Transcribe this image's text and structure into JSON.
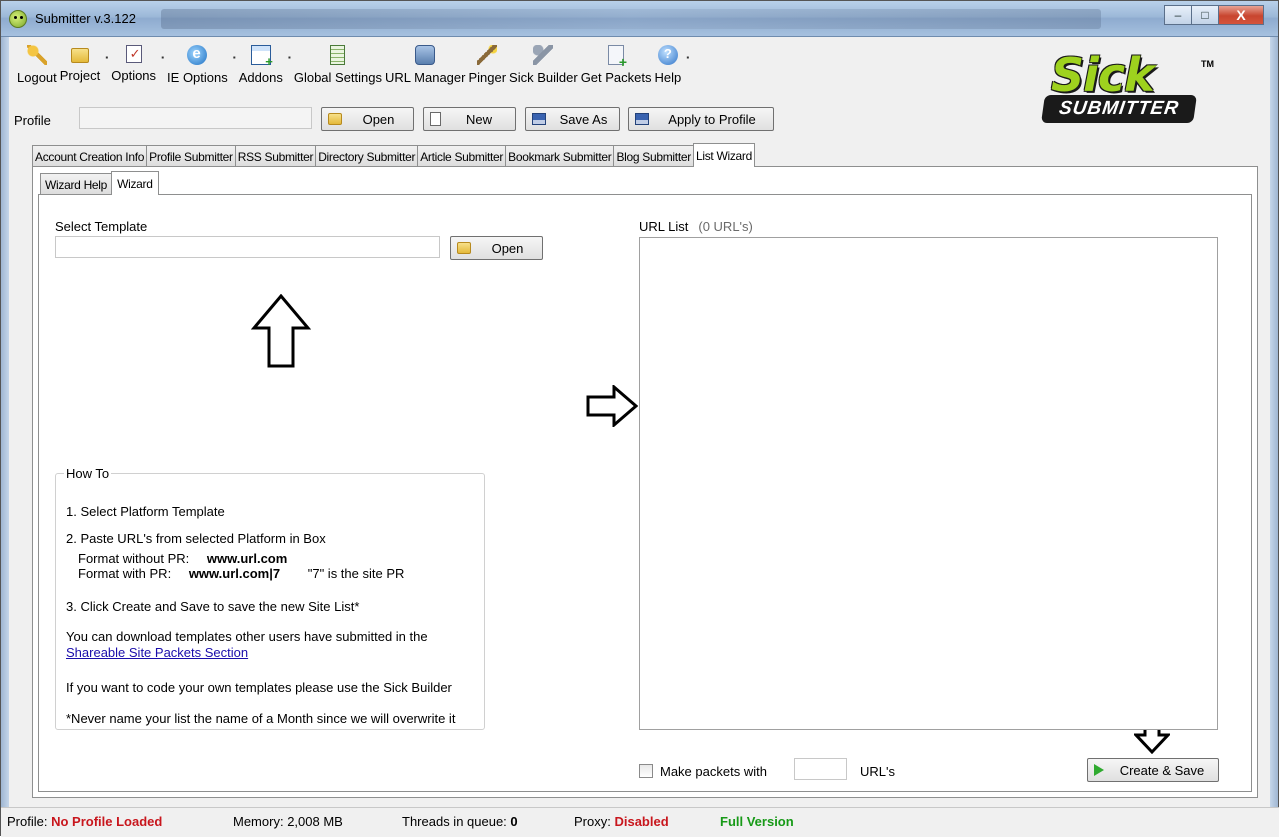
{
  "window": {
    "title": "Submitter v.3.122",
    "minimize": "–",
    "maximize": "□",
    "close": "X"
  },
  "toolbar": {
    "items": [
      {
        "label": "Logout",
        "icon": "key-icon"
      },
      {
        "label": "Project",
        "icon": "folder-icon"
      },
      {
        "label": "Options",
        "icon": "checklist-icon"
      },
      {
        "label": "IE Options",
        "icon": "ie-icon"
      },
      {
        "label": "Addons",
        "icon": "add-window-icon"
      },
      {
        "label": "Global Settings",
        "icon": "document-icon"
      },
      {
        "label": "URL Manager",
        "icon": "globe-icon"
      },
      {
        "label": "Pinger",
        "icon": "wand-icon"
      },
      {
        "label": "Sick Builder",
        "icon": "wrench-icon"
      },
      {
        "label": "Get Packets",
        "icon": "packets-icon"
      },
      {
        "label": "Help",
        "icon": "help-icon"
      }
    ]
  },
  "logo": {
    "top": "Sick",
    "bottom": "SUBMITTER",
    "tm": "TM"
  },
  "profile": {
    "label": "Profile",
    "value": "",
    "open": "Open",
    "new": "New",
    "save_as": "Save As",
    "apply": "Apply to Profile"
  },
  "tabs": [
    "Account Creation Info",
    "Profile Submitter",
    "RSS Submitter",
    "Directory Submitter",
    "Article Submitter",
    "Bookmark Submitter",
    "Blog Submitter",
    "List Wizard"
  ],
  "subtabs": [
    "Wizard Help",
    "Wizard"
  ],
  "wizard": {
    "select_template": "Select Template",
    "template_value": "",
    "open": "Open",
    "url_list": "URL List",
    "url_count": "(0 URL's)",
    "url_text": "",
    "make_packets": "Make packets with",
    "packet_size": "",
    "urls_suffix": "URL's",
    "create_save": "Create & Save"
  },
  "howto": {
    "title": "How To",
    "step1": "1. Select Platform Template",
    "step2": "2. Paste URL's from selected Platform in Box",
    "fmt_without_label": "Format without PR:",
    "fmt_without_value": "www.url.com",
    "fmt_with_label": "Format with PR:",
    "fmt_with_value": "www.url.com|7",
    "fmt_with_note": "\"7\" is the site PR",
    "step3": "3. Click Create and Save to save the new Site List*",
    "download_text": "You can download templates other users have submitted in the",
    "download_link": "Shareable Site Packets Section",
    "code_text": "If you want to code your own templates please use the Sick Builder",
    "never_text": "*Never name your list the name of a Month since we will overwrite it"
  },
  "status": {
    "profile_label": "Profile:",
    "profile_value": "No Profile Loaded",
    "memory_label": "Memory:",
    "memory_value": "2,008 MB",
    "threads_label": "Threads in queue:",
    "threads_value": "0",
    "proxy_label": "Proxy:",
    "proxy_value": "Disabled",
    "version": "Full Version"
  }
}
